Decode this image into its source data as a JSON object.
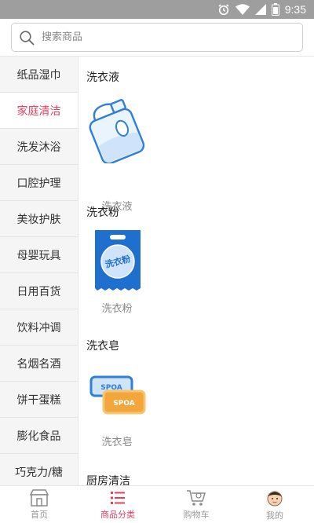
{
  "status_bar": {
    "time": "9:35"
  },
  "search": {
    "placeholder": "搜索商品"
  },
  "sidebar": {
    "items": [
      {
        "label": "纸品湿巾"
      },
      {
        "label": "家庭清洁"
      },
      {
        "label": "洗发沐浴"
      },
      {
        "label": "口腔护理"
      },
      {
        "label": "美妆护肤"
      },
      {
        "label": "母婴玩具"
      },
      {
        "label": "日用百货"
      },
      {
        "label": "饮料冲调"
      },
      {
        "label": "名烟名酒"
      },
      {
        "label": "饼干蛋糕"
      },
      {
        "label": "膨化食品"
      },
      {
        "label": "巧克力/糖"
      }
    ],
    "active_index": 1
  },
  "content": {
    "sections": [
      {
        "title": "洗衣液",
        "product": {
          "name": "洗衣液",
          "icon": "detergent-bottle-icon"
        }
      },
      {
        "title": "洗衣粉",
        "product": {
          "name": "洗衣粉",
          "icon": "washing-powder-bag-icon",
          "bag_text": "洗衣粉"
        }
      },
      {
        "title": "洗衣皂",
        "product": {
          "name": "洗衣皂",
          "icon": "soap-bar-icon",
          "soap_text": "SPOA"
        }
      },
      {
        "title": "厨房清洁"
      }
    ]
  },
  "tab_bar": {
    "tabs": [
      {
        "label": "首页",
        "icon": "store-icon"
      },
      {
        "label": "商品分类",
        "icon": "category-list-icon"
      },
      {
        "label": "购物车",
        "icon": "cart-icon"
      },
      {
        "label": "我的",
        "icon": "profile-avatar-icon"
      }
    ],
    "active_index": 1
  },
  "colors": {
    "accent": "#e83e5d",
    "status_bar": "#9e9e9e"
  }
}
